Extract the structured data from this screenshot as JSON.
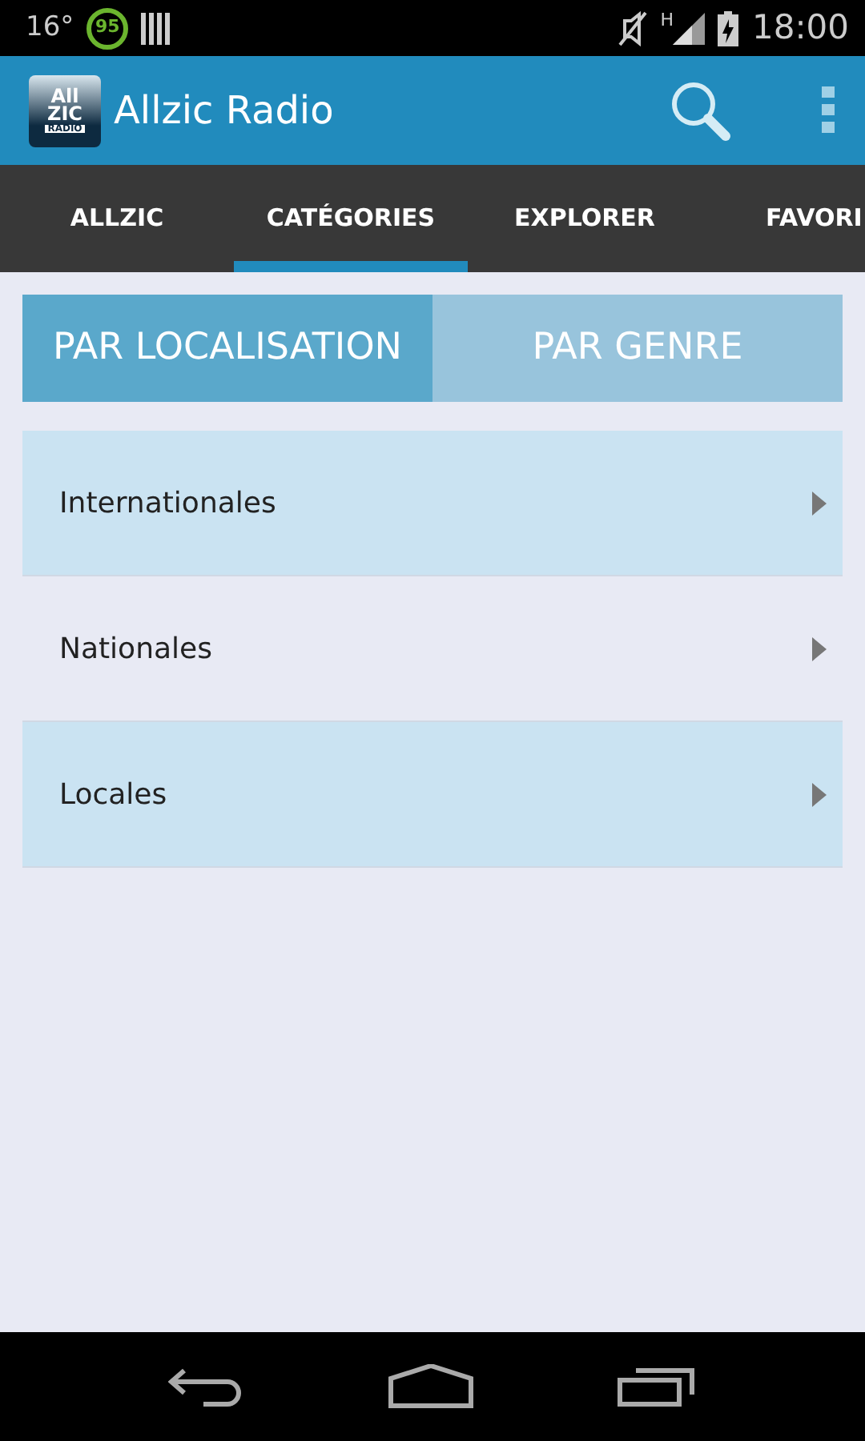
{
  "status_bar": {
    "temperature": "16°",
    "battery_badge": "95",
    "network": "H",
    "time": "18:00"
  },
  "action_bar": {
    "logo": [
      "All",
      "ZIC",
      "RADIO"
    ],
    "title": "Allzic Radio"
  },
  "tabs": [
    {
      "label": "ALLZIC",
      "selected": false
    },
    {
      "label": "CATÉGORIES",
      "selected": true
    },
    {
      "label": "EXPLORER",
      "selected": false
    },
    {
      "label": "FAVORI",
      "selected": false
    }
  ],
  "segments": [
    {
      "label": "PAR LOCALISATION",
      "selected": true
    },
    {
      "label": "PAR GENRE",
      "selected": false
    }
  ],
  "categories": [
    {
      "label": "Internationales"
    },
    {
      "label": "Nationales"
    },
    {
      "label": "Locales"
    }
  ]
}
